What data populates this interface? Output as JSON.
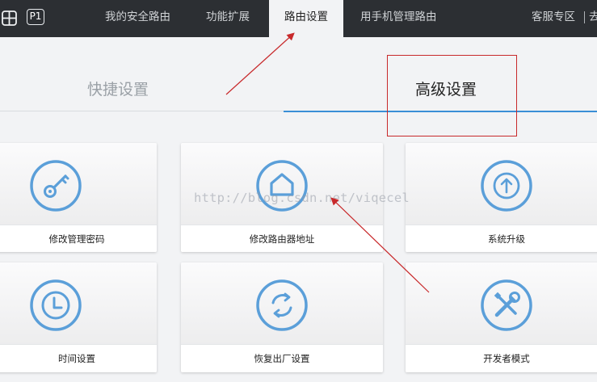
{
  "nav": {
    "badge": "P1",
    "items": [
      "我的安全路由",
      "功能扩展",
      "路由设置",
      "用手机管理路由"
    ],
    "active_index": 2,
    "right_items": [
      "客服专区",
      "去"
    ]
  },
  "tabs": {
    "quick": "快捷设置",
    "advanced": "高级设置",
    "active": "advanced"
  },
  "cards": [
    {
      "label": "修改管理密码",
      "icon": "key-icon"
    },
    {
      "label": "修改路由器地址",
      "icon": "home-icon"
    },
    {
      "label": "系统升级",
      "icon": "upgrade-arrow-icon"
    },
    {
      "label": "时间设置",
      "icon": "clock-icon"
    },
    {
      "label": "恢复出厂设置",
      "icon": "refresh-icon"
    },
    {
      "label": "开发者模式",
      "icon": "tools-icon"
    }
  ],
  "watermark": "http://blog.csdn.net/viqecel",
  "colors": {
    "topbar": "#2c2f33",
    "accent": "#3a8ed6",
    "icon": "#5b9fd9",
    "annotation": "#c8292b"
  }
}
